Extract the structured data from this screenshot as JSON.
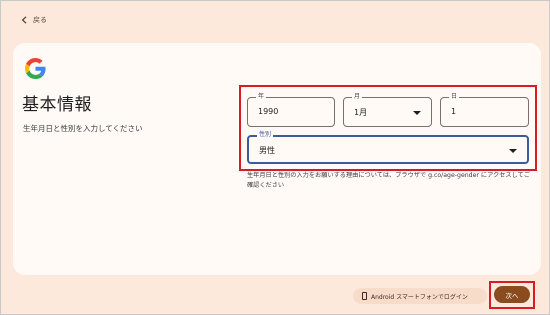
{
  "header": {
    "back_label": "戻る"
  },
  "main": {
    "title": "基本情報",
    "subtitle": "生年月日と性別を入力してください"
  },
  "form": {
    "year": {
      "label": "年",
      "value": "1990"
    },
    "month": {
      "label": "月",
      "value": "1月"
    },
    "day": {
      "label": "日",
      "value": "1"
    },
    "gender": {
      "label": "性別",
      "value": "男性"
    },
    "info_text": "生年月日と性別の入力をお願いする理由については、ブラウザで g.co/age-gender にアクセスしてご確認ください"
  },
  "footer": {
    "android_login_label": "Android スマートフォンでログイン",
    "next_label": "次へ"
  },
  "colors": {
    "background": "#fde9dc",
    "card": "#fffaf6",
    "accent_brown": "#8a4b1f",
    "focus_blue": "#3c5b9a",
    "highlight_red": "#d81b24",
    "google_blue": "#4285F4",
    "google_red": "#EA4335",
    "google_yellow": "#FBBC05",
    "google_green": "#34A853"
  }
}
